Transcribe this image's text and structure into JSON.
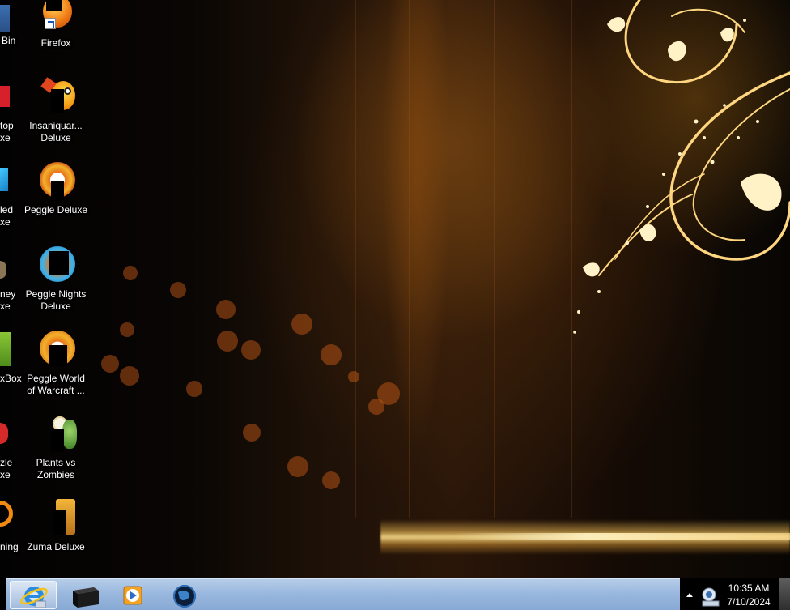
{
  "desktop": {
    "icons_full": [
      {
        "label": "Firefox",
        "icon": "firefox-icon"
      },
      {
        "label": "Insaniquar...\nDeluxe",
        "icon": "insaniquarium-fish-icon"
      },
      {
        "label": "Peggle Deluxe",
        "icon": "peggle-icon"
      },
      {
        "label": "Peggle Nights\nDeluxe",
        "icon": "peggle-nights-icon"
      },
      {
        "label": "Peggle World\nof Warcraft ...",
        "icon": "peggle-wow-icon"
      },
      {
        "label": "Plants vs\nZombies",
        "icon": "plants-vs-zombies-icon"
      },
      {
        "label": "Zuma Deluxe",
        "icon": "zuma-icon"
      }
    ],
    "icons_cut": [
      {
        "label": "Bin",
        "icon": "recycle-bin-icon"
      },
      {
        "label": "top\nxe",
        "icon": "cut-red-app-icon"
      },
      {
        "label": "led\nxe",
        "icon": "cut-blue-app-icon"
      },
      {
        "label": "ney\nxe",
        "icon": "cut-brown-app-icon"
      },
      {
        "label": "xBox",
        "icon": "cut-green-app-icon"
      },
      {
        "label": "zle\nxe",
        "icon": "cut-red-circle-icon"
      },
      {
        "label": "ning",
        "icon": "cut-orange-ring-icon"
      }
    ]
  },
  "taskbar": {
    "pinned": [
      {
        "name": "internet-explorer",
        "icon": "internet-explorer-icon"
      },
      {
        "name": "file-app",
        "icon": "black-box-app-icon"
      },
      {
        "name": "media-player",
        "icon": "media-player-icon"
      },
      {
        "name": "globe-app",
        "icon": "globe-icon"
      }
    ],
    "tray": {
      "show_hidden_icon": "up-arrow-icon",
      "network_icon": "network-icon"
    },
    "clock": {
      "time": "10:35 AM",
      "date": "7/10/2024"
    }
  },
  "colors": {
    "taskbar_glass": "#9ab8de",
    "accent_gold": "#ffd27a",
    "label_text": "#ffffff"
  }
}
